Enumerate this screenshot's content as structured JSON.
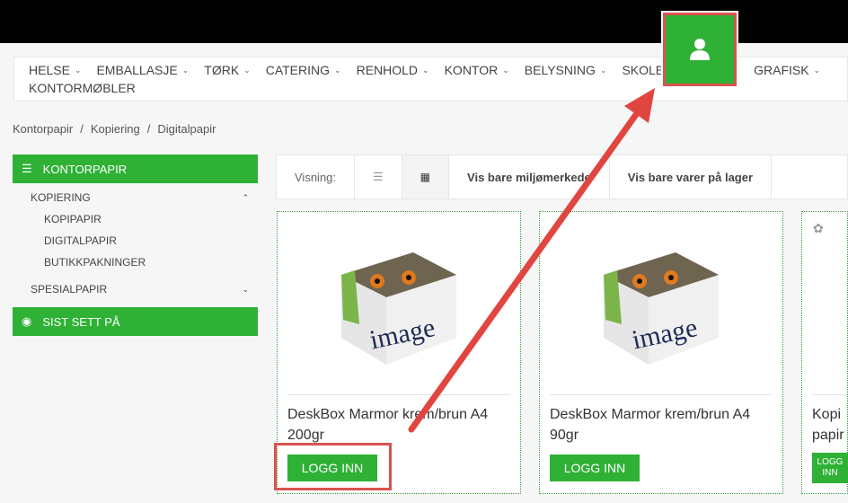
{
  "nav": {
    "items": [
      "HELSE",
      "EMBALLASJE",
      "TØRK",
      "CATERING",
      "RENHOLD",
      "KONTOR",
      "BELYSNING",
      "SKOLE",
      "GRAFISK",
      "KONTORMØBLER"
    ]
  },
  "user_button": {
    "icon": "user-icon",
    "color": "#2eb135"
  },
  "breadcrumb": [
    "Kontorpapir",
    "Kopiering",
    "Digitalpapir"
  ],
  "sidebar": {
    "header": "KONTORPAPIR",
    "items": [
      {
        "label": "KOPIERING",
        "expanded": true
      },
      {
        "label": "KOPIPAPIR"
      },
      {
        "label": "DIGITALPAPIR"
      },
      {
        "label": "BUTIKKPAKNINGER"
      },
      {
        "label": "SPESIALPAPIR",
        "expanded": false
      }
    ],
    "recent": "SIST SETT PÅ"
  },
  "toolbar": {
    "view_label": "Visning:",
    "filter_eco": "Vis bare miljømerkede",
    "filter_stock": "Vis bare varer på lager"
  },
  "products": [
    {
      "title": "DeskBox Marmor krem/brun A4 200gr",
      "button": "LOGG INN",
      "image_brand": "image"
    },
    {
      "title": "DeskBox Marmor krem/brun A4 90gr",
      "button": "LOGG INN",
      "image_brand": "image"
    },
    {
      "title": "Kopipapir",
      "button": "LOGG INN"
    }
  ],
  "colors": {
    "accent": "#2eb135",
    "annotation": "#d9534f"
  }
}
